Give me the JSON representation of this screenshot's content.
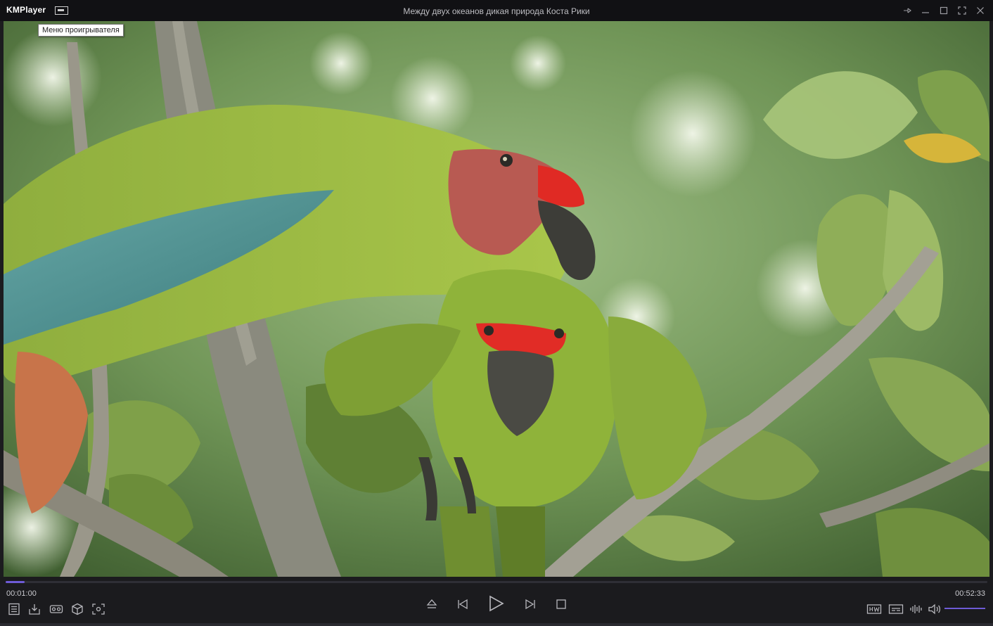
{
  "app": {
    "name": "KMPlayer",
    "window_title": "Между двух океанов дикая природа Коста Рики"
  },
  "tooltip": {
    "text": "Меню проигрывателя"
  },
  "playback": {
    "current_time": "00:01:00",
    "total_time": "00:52:33",
    "progress_fraction": 0.019,
    "volume_fraction": 1.0
  },
  "colors": {
    "accent": "#6e5bd6",
    "background": "#1b1b1e",
    "titlebar": "#111114"
  },
  "icons": {
    "window": [
      "pin-icon",
      "minimize-icon",
      "maximize-icon",
      "fullscreen-icon",
      "close-icon"
    ],
    "left_controls": [
      "playlist-icon",
      "download-icon",
      "vr-icon",
      "3d-icon",
      "capture-icon"
    ],
    "center_controls": [
      "eject-icon",
      "previous-icon",
      "play-icon",
      "next-icon",
      "stop-icon"
    ],
    "right_controls": [
      "hw-decoder-icon",
      "subtitle-icon",
      "equalizer-icon",
      "volume-icon"
    ]
  }
}
